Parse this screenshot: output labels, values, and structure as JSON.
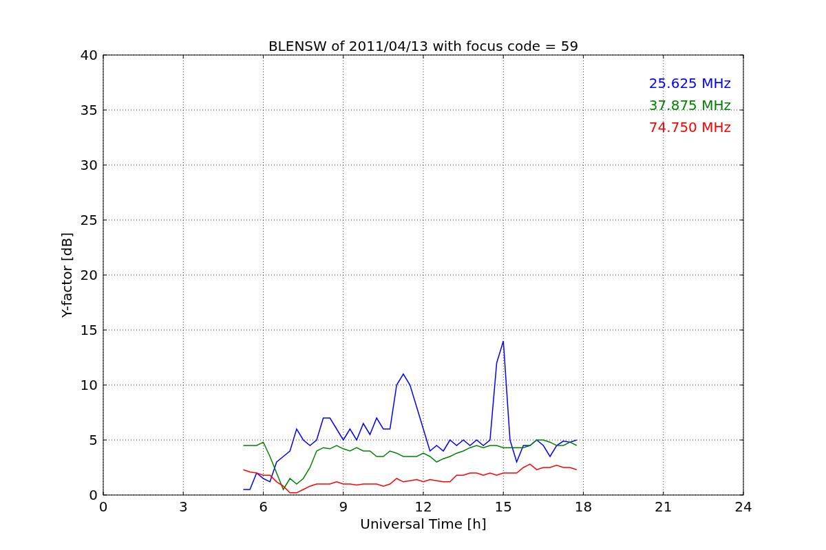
{
  "chart_data": {
    "type": "line",
    "title": "BLENSW of 2011/04/13 with focus code = 59",
    "xlabel": "Universal Time [h]",
    "ylabel": "Y-factor [dB]",
    "xlim": [
      0,
      24
    ],
    "ylim": [
      0,
      40
    ],
    "xticks": [
      0,
      3,
      6,
      9,
      12,
      15,
      18,
      21,
      24
    ],
    "yticks": [
      0,
      5,
      10,
      15,
      20,
      25,
      30,
      35,
      40
    ],
    "grid": true,
    "x": [
      5.25,
      5.5,
      5.75,
      6,
      6.25,
      6.5,
      6.75,
      7,
      7.25,
      7.5,
      7.75,
      8,
      8.25,
      8.5,
      8.75,
      9,
      9.25,
      9.5,
      9.75,
      10,
      10.25,
      10.5,
      10.75,
      11,
      11.25,
      11.5,
      11.75,
      12,
      12.25,
      12.5,
      12.75,
      13,
      13.25,
      13.5,
      13.75,
      14,
      14.25,
      14.5,
      14.75,
      15,
      15.25,
      15.5,
      15.75,
      16,
      16.25,
      16.5,
      16.75,
      17,
      17.25,
      17.5,
      17.75
    ],
    "series": [
      {
        "name": "25.625 MHz",
        "color": "#0000ff",
        "values": [
          0.5,
          0.5,
          2,
          1.5,
          1.2,
          3,
          3.5,
          4,
          6,
          5,
          4.5,
          5,
          7,
          7,
          6,
          5,
          6,
          5,
          6.5,
          5.5,
          7,
          6,
          6,
          10,
          11,
          10,
          8,
          6,
          4,
          4.5,
          4,
          5,
          4.5,
          5,
          4.5,
          5,
          4.5,
          5,
          12,
          14,
          5,
          3,
          4.5,
          4.5,
          5,
          4.5,
          3.5,
          4.5,
          4.9,
          4.8,
          5
        ]
      },
      {
        "name": "37.875 MHz",
        "color": "#008000",
        "values": [
          4.5,
          4.5,
          4.5,
          4.8,
          3.5,
          2,
          0.5,
          1.5,
          1,
          1.5,
          2.5,
          4,
          4.3,
          4.2,
          4.5,
          4.2,
          4,
          4.3,
          4,
          4,
          3.5,
          3.5,
          4,
          3.8,
          3.5,
          3.5,
          3.5,
          3.8,
          3.5,
          3,
          3.3,
          3.5,
          3.8,
          4,
          4.3,
          4.5,
          4.3,
          4.5,
          4.5,
          4.3,
          4.3,
          4.3,
          4.3,
          4.5,
          5,
          5,
          4.8,
          4.5,
          4.5,
          4.8,
          4.5
        ]
      },
      {
        "name": "74.750 MHz",
        "color": "#ff0000",
        "values": [
          2.3,
          2.1,
          2,
          1.8,
          1.8,
          1.2,
          0.8,
          0.2,
          0.2,
          0.5,
          0.8,
          1,
          1,
          1,
          1.2,
          1,
          1,
          0.9,
          1,
          1,
          1,
          0.8,
          1,
          1.5,
          1.2,
          1.3,
          1.4,
          1.2,
          1.4,
          1.3,
          1.2,
          1.2,
          1.8,
          1.8,
          2,
          2,
          1.8,
          2,
          1.8,
          2,
          2,
          2,
          2.5,
          2.8,
          2.3,
          2.5,
          2.5,
          2.7,
          2.5,
          2.5,
          2.3
        ]
      }
    ]
  }
}
